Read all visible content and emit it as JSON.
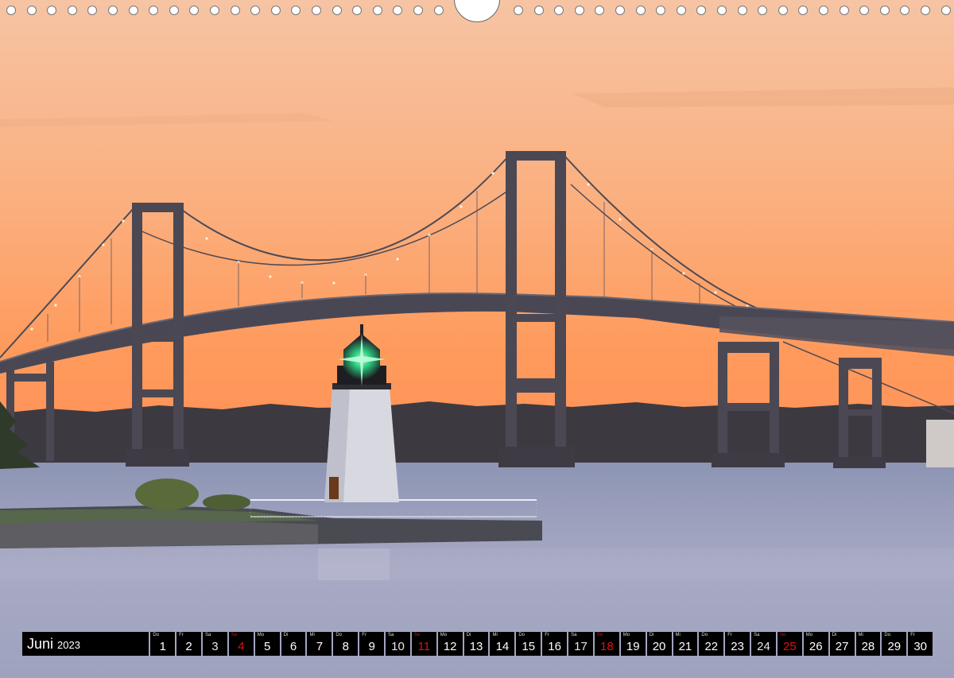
{
  "photo": {
    "subject": "Claiborne Pell Newport Bridge with Goat Island Lighthouse at dusk",
    "colors": {
      "sky_top": "#f7b98e",
      "sky_horizon": "#ff9a5a",
      "water": "#9aa0bb",
      "structure": "#4a4a5a"
    }
  },
  "binding": {
    "hole_count_left": 22,
    "hole_count_right": 22
  },
  "calendar": {
    "month": "Juni",
    "year": "2023",
    "days": [
      {
        "wd": "Do",
        "d": "1"
      },
      {
        "wd": "Fr",
        "d": "2"
      },
      {
        "wd": "Sa",
        "d": "3"
      },
      {
        "wd": "So",
        "d": "4"
      },
      {
        "wd": "Mo",
        "d": "5"
      },
      {
        "wd": "Di",
        "d": "6"
      },
      {
        "wd": "Mi",
        "d": "7"
      },
      {
        "wd": "Do",
        "d": "8"
      },
      {
        "wd": "Fr",
        "d": "9"
      },
      {
        "wd": "Sa",
        "d": "10"
      },
      {
        "wd": "So",
        "d": "11"
      },
      {
        "wd": "Mo",
        "d": "12"
      },
      {
        "wd": "Di",
        "d": "13"
      },
      {
        "wd": "Mi",
        "d": "14"
      },
      {
        "wd": "Do",
        "d": "15"
      },
      {
        "wd": "Fr",
        "d": "16"
      },
      {
        "wd": "Sa",
        "d": "17"
      },
      {
        "wd": "So",
        "d": "18"
      },
      {
        "wd": "Mo",
        "d": "19"
      },
      {
        "wd": "Di",
        "d": "20"
      },
      {
        "wd": "Mi",
        "d": "21"
      },
      {
        "wd": "Do",
        "d": "22"
      },
      {
        "wd": "Fr",
        "d": "23"
      },
      {
        "wd": "Sa",
        "d": "24"
      },
      {
        "wd": "So",
        "d": "25"
      },
      {
        "wd": "Mo",
        "d": "26"
      },
      {
        "wd": "Di",
        "d": "27"
      },
      {
        "wd": "Mi",
        "d": "28"
      },
      {
        "wd": "Do",
        "d": "29"
      },
      {
        "wd": "Fr",
        "d": "30"
      }
    ],
    "sunday_color": "#e01010"
  }
}
